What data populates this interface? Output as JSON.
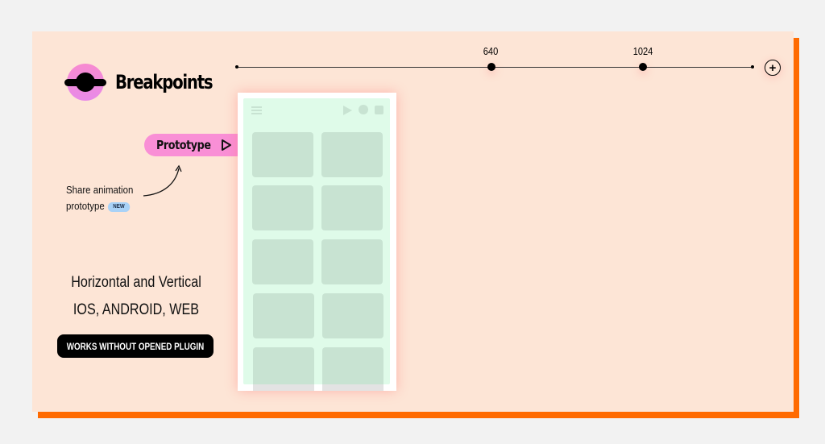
{
  "app": {
    "title": "Breakpoints",
    "logo_icon": "breakpoints-logo-icon",
    "colors": {
      "page_bg": "#f2f2f2",
      "card_bg": "#fde5d6",
      "accent_orange": "#ff6a00",
      "pink": "#f98fd6",
      "badge_blue": "#a9d2f7",
      "mockup_green": "#dffbe9",
      "tile_green": "#c8e3d2"
    }
  },
  "breakpoints": {
    "items": [
      {
        "label": "640"
      },
      {
        "label": "1024"
      }
    ],
    "add_icon": "plus-circle-icon",
    "add_label": "+"
  },
  "prototype": {
    "button_label": "Prototype",
    "icon": "play-icon"
  },
  "annotation": {
    "line1": "Share animation",
    "line2": "prototype",
    "badge": "NEW",
    "arrow_icon": "curved-arrow-icon"
  },
  "features": {
    "line1": "Horizontal and Vertical",
    "line2": "IOS, ANDROID, WEB",
    "button_label": "WORKS WITHOUT OPENED PLUGIN"
  },
  "mockup": {
    "toolbar_icons": [
      "menu-icon",
      "play-icon",
      "record-icon",
      "stop-icon"
    ],
    "tile_rows": 5,
    "tile_cols": 2
  }
}
